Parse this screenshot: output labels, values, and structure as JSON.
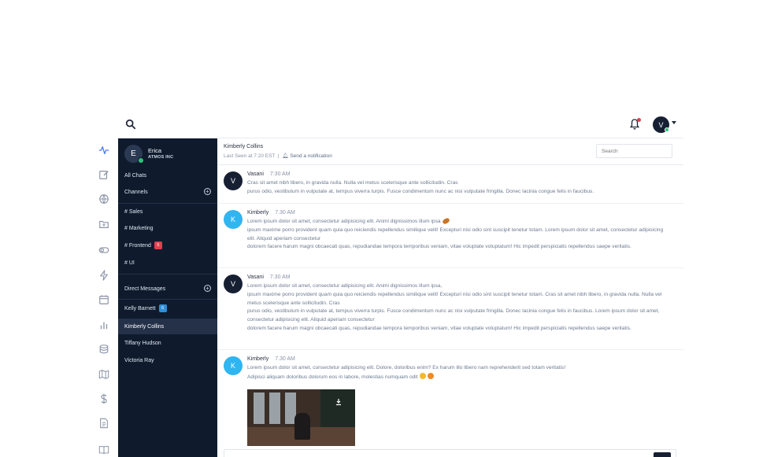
{
  "topbar": {
    "search_icon": "search-icon",
    "bell_icon": "bell-icon",
    "user_initial": "V"
  },
  "rail": {
    "icons": [
      "activity-icon",
      "edit-icon",
      "globe-icon",
      "folder-icon",
      "toggle-icon",
      "lightning-icon",
      "calendar-icon",
      "bar-chart-icon",
      "database-icon",
      "map-icon",
      "dollar-icon",
      "file-icon",
      "book-icon"
    ]
  },
  "profile": {
    "initial": "E",
    "name": "Erica",
    "company": "ATMOS INC"
  },
  "sidebar": {
    "all_chats": "All Chats",
    "channels_label": "Channels",
    "channels": [
      {
        "label": "# Sales",
        "badge": ""
      },
      {
        "label": "# Marketing",
        "badge": ""
      },
      {
        "label": "# Frontend",
        "badge": "5"
      },
      {
        "label": "# UI",
        "badge": ""
      }
    ],
    "dm_label": "Direct Messages",
    "dms": [
      {
        "label": "Kelly Barnett",
        "badge": "6"
      },
      {
        "label": "Kimberly Collins",
        "badge": ""
      },
      {
        "label": "Tiffany Hudson",
        "badge": ""
      },
      {
        "label": "Victoria Ray",
        "badge": ""
      }
    ]
  },
  "conversation": {
    "name": "Kimberly Collins",
    "last_seen": "Last Seen at 7:20 EST",
    "separator": "|",
    "notify": "Send a notification",
    "search_placeholder": "Search"
  },
  "messages": [
    {
      "initial": "V",
      "author": "Vasani",
      "time": "7:30 AM",
      "lines": [
        "Cras sit amet nibh libero, in gravida nulla. Nulla vel metus scelerisque ante sollicitudin. Cras",
        "purus odio, vestibulum in vulputate at, tempus viverra turpis. Fusce condimentum nunc ac nisi vulputate fringilla. Donec lacinia congue felis in faucibus."
      ]
    },
    {
      "initial": "K",
      "author": "Kimberly",
      "time": "7.30 AM",
      "lines": [
        "Lorem ipsum dolor sit amet, consectetur adipisicing elit. Animi dignissimos illum ipsa",
        "ipsum maxime porro provident quam quia quo reiciendis repellendus similique velit! Excepturi nisi odio sint suscipit tenetur totam. Lorem ipsum dolor sit amet, consectetur adipisicing elit. Aliquid aperiam consectetur",
        "dolorem facere harum magni obcaecati quas, repudiandae tempora temporibus veniam, vitae voluptate voluptatum! Hic impedit perspiciatis repellendus saepe veritatis."
      ]
    },
    {
      "initial": "V",
      "author": "Vasani",
      "time": "7.30 AM",
      "lines": [
        "Lorem ipsum dolor sit amet, consectetur adipisicing elit. Animi dignissimos illum ipsa,",
        "ipsum maxime porro provident quam quia quo reiciendis repellendus similique velit! Excepturi nisi odio sint suscipit tenetur totam. Cras sit amet nibh libero, in gravida nulla. Nulla vel metus scelerisque ante sollicitudin. Cras",
        "purus odio, vestibulum in vulputate at, tempus viverra turpis. Fusce condimentum nunc ac nisi vulputate fringilla. Donec lacinia congue felis in faucibus. Lorem ipsum dolor sit amet, consectetur adipisicing elit. Aliquid aperiam consectetur",
        "dolorem facere harum magni obcaecati quas, repudiandae tempora temporibus veniam, vitae voluptate voluptatum! Hic impedit perspiciatis repellendus saepe veritatis."
      ]
    },
    {
      "initial": "K",
      "author": "Kimberly",
      "time": "7.30 AM",
      "lines": [
        "Lorem ipsum dolor sit amet, consectetur adipisicing elit. Dolore, doloribus enim? Ex harum illo libero nam reprehenderit sed totam veritatis!",
        "Adipisci aliquam doloribus dolorum eos in labore, molestias numquam odit"
      ]
    }
  ]
}
